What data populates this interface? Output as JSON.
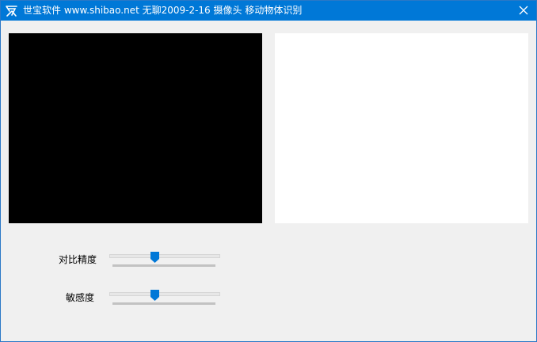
{
  "window": {
    "title": "世宝软件  www.shibao.net   无聊2009-2-16  摄像头 移动物体识别",
    "icon": "app-logo-icon",
    "close_icon": "close-icon",
    "title_bar_color": "#0078d7",
    "background_color": "#f0f0f0"
  },
  "video_panes": {
    "left_color": "#000000",
    "right_color": "#ffffff"
  },
  "controls": {
    "contrast_label": "对比精度",
    "contrast_value": 0.4,
    "sensitivity_label": "敏感度",
    "sensitivity_value": 0.4,
    "slider_accent": "#0078d7"
  }
}
